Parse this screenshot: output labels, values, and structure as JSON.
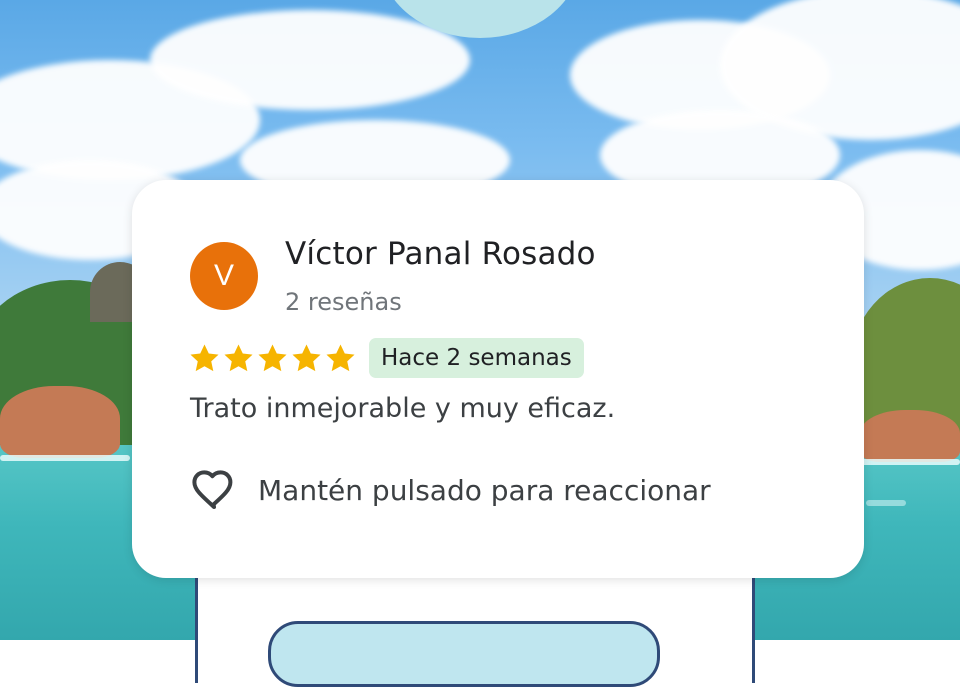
{
  "review": {
    "author_initial": "V",
    "author_name": "Víctor Panal Rosado",
    "review_count": "2 reseñas",
    "rating": 5,
    "rating_max": 5,
    "time_ago": "Hace 2 semanas",
    "text": "Trato inmejorable y muy eficaz.",
    "react_hint": "Mantén pulsado para reaccionar"
  },
  "colors": {
    "avatar": "#e8710a",
    "star": "#f6b400",
    "time_badge_bg": "#d7f0dd",
    "sheet_border": "#2f4a78"
  },
  "icons": {
    "rating": "star-icon",
    "react": "heart-outline-icon"
  }
}
